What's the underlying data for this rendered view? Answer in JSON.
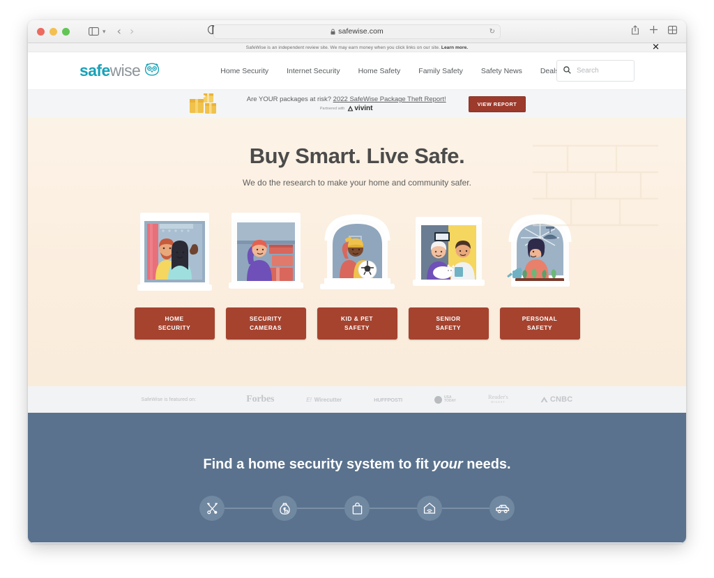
{
  "browser": {
    "url": "safewise.com",
    "lock_icon": "lock-icon",
    "reload_icon": "reload-icon",
    "sidebar_icon": "sidebar-toggle-icon",
    "chevron_icon": "chevron-down-icon",
    "back_icon": "back-arrow-icon",
    "forward_icon": "forward-arrow-icon",
    "reader_icon": "reader-view-icon",
    "share_icon": "share-icon",
    "newtab_icon": "plus-icon",
    "tabs_icon": "tab-overview-icon",
    "traffic_lights": [
      "close-red",
      "minimize-yellow",
      "zoom-green"
    ]
  },
  "disclosure": {
    "text": "SafeWise is an independent review site. We may earn money when you click links on our site. ",
    "link": "Learn more.",
    "close_label": "✕"
  },
  "header": {
    "logo": {
      "part1": "safe",
      "part2": "wise",
      "icon": "owl-icon"
    },
    "nav": [
      {
        "label": "Home Security"
      },
      {
        "label": "Internet Security"
      },
      {
        "label": "Home Safety"
      },
      {
        "label": "Family Safety"
      },
      {
        "label": "Safety News"
      },
      {
        "label": "Deals"
      }
    ],
    "search": {
      "placeholder": "Search",
      "icon": "search-icon",
      "value": ""
    }
  },
  "promo": {
    "question": "Are YOUR packages at risk? ",
    "link": "2022 SafeWise Package Theft Report!",
    "partner_prefix": "Partnered with",
    "partner_brand": "vivint",
    "cta": "VIEW REPORT",
    "boxes_icon": "packages-icon"
  },
  "hero": {
    "title": "Buy Smart. Live Safe.",
    "subtitle": "We do the research to make your home and community safer.",
    "cards": [
      {
        "illustration": "window-couple-illustration",
        "line1": "HOME",
        "line2": "SECURITY"
      },
      {
        "illustration": "window-waving-man-illustration",
        "line1": "SECURITY",
        "line2": "CAMERAS"
      },
      {
        "illustration": "window-kid-soccer-illustration",
        "line1": "KID & PET",
        "line2": "SAFETY"
      },
      {
        "illustration": "window-seniors-cat-illustration",
        "line1": "SENIOR",
        "line2": "SAFETY"
      },
      {
        "illustration": "window-watering-plants-illustration",
        "line1": "PERSONAL",
        "line2": "SAFETY"
      }
    ]
  },
  "press": {
    "label": "SafeWise is featured on:",
    "logos": [
      {
        "name": "forbes-logo",
        "text": "Forbes"
      },
      {
        "name": "wirecutter-logo",
        "text": "Wirecutter",
        "prefix": "E!"
      },
      {
        "name": "huffpost-logo",
        "text": "HUFFPOSTI"
      },
      {
        "name": "usatoday-logo",
        "line1": "USA",
        "line2": "TODAY"
      },
      {
        "name": "readers-digest-logo",
        "line1": "Reader's",
        "line2": "DIGEST"
      },
      {
        "name": "cnbc-logo",
        "text": "CNBC"
      }
    ]
  },
  "blue_section": {
    "title_pre": "Find a home security system to fit ",
    "title_em": "your",
    "title_post": " needs.",
    "steps": [
      {
        "icon": "tools-icon",
        "name": "installation"
      },
      {
        "icon": "money-bag-icon",
        "name": "cost"
      },
      {
        "icon": "shopping-bag-icon",
        "name": "shopping"
      },
      {
        "icon": "smart-home-icon",
        "name": "smart-home"
      },
      {
        "icon": "car-icon",
        "name": "vehicle"
      }
    ]
  },
  "colors": {
    "brand_teal": "#18a2b8",
    "brand_gray": "#8d9499",
    "cta_red": "#a5432f",
    "promo_red": "#9c3a2c",
    "hero_bg": "#fbeedf",
    "blue_bg": "#5a728d",
    "press_bg": "#f2f3f4"
  }
}
